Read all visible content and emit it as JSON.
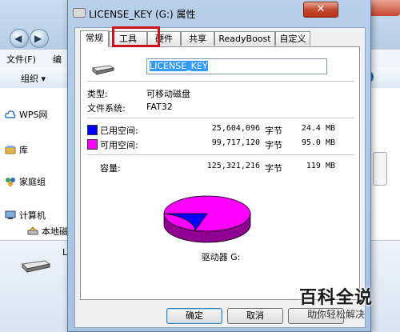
{
  "background": {
    "menu": [
      "文件(F)",
      "编"
    ],
    "toolbar_organize": "组织 ▾",
    "search_hint": "算机",
    "help_glyph": "?",
    "sidebar": [
      "WPS网",
      "库",
      "家庭组",
      "计算机",
      "本地磁"
    ],
    "status_label": "L"
  },
  "dialog": {
    "title": "LICENSE_KEY (G:) 属性",
    "close_glyph": "✕",
    "tabs": [
      {
        "label": "常规",
        "active": true
      },
      {
        "label": "工具",
        "active": false
      },
      {
        "label": "硬件",
        "active": false
      },
      {
        "label": "共享",
        "active": false
      },
      {
        "label": "ReadyBoost",
        "active": false
      },
      {
        "label": "自定义",
        "active": false
      }
    ],
    "volume_label": "LICENSE_KEY",
    "type_label": "类型:",
    "type_value": "可移动磁盘",
    "fs_label": "文件系统:",
    "fs_value": "FAT32",
    "used": {
      "label": "已用空间:",
      "bytes": "25,604,096",
      "unit": "字节",
      "readable": "24.4 MB",
      "color": "#0000ff"
    },
    "free": {
      "label": "可用空间:",
      "bytes": "99,717,120",
      "unit": "字节",
      "readable": "95.0 MB",
      "color": "#ff00ff"
    },
    "capacity": {
      "label": "容量:",
      "bytes": "125,321,216",
      "unit": "字节",
      "readable": "119 MB"
    },
    "drive_caption": "驱动器 G:",
    "buttons": {
      "ok": "确定",
      "cancel": "取消",
      "apply": "应"
    }
  },
  "watermark": {
    "main": "百科全说",
    "sub": "助你轻松解决"
  }
}
